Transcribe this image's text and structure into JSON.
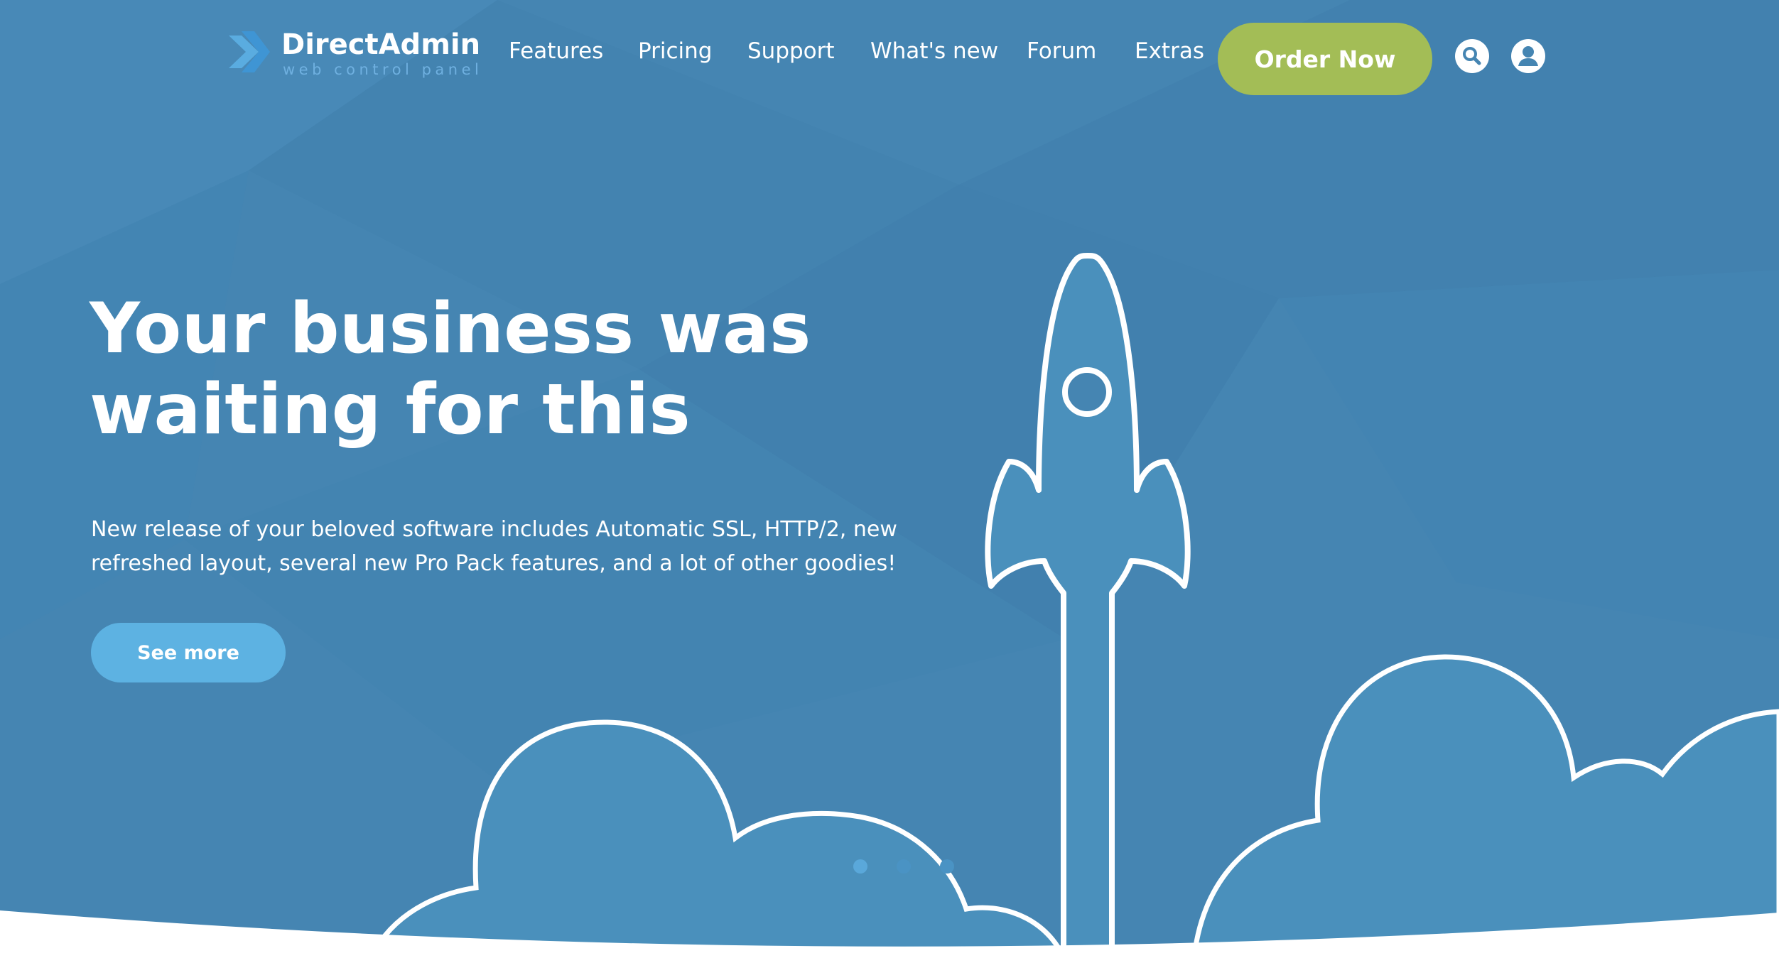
{
  "colors": {
    "background": "#4585b2",
    "cta_green": "#a3bd56",
    "secondary_button": "#5db2e2",
    "cloud_fill": "#4a90bc",
    "white": "#ffffff",
    "logo_accent": "#5aace0"
  },
  "logo": {
    "name": "DirectAdmin",
    "tagline": "web control panel",
    "icon": "directadmin-chevron-icon"
  },
  "nav": {
    "links": [
      {
        "label": "Features"
      },
      {
        "label": "Pricing"
      },
      {
        "label": "Support"
      },
      {
        "label": "What's new"
      },
      {
        "label": "Forum"
      },
      {
        "label": "Extras"
      }
    ],
    "order_label": "Order Now",
    "search_icon": "search-icon",
    "account_icon": "user-account-icon"
  },
  "hero": {
    "title_line1": "Your business was",
    "title_line2": "waiting for this",
    "description": "New release of your beloved software includes Automatic SSL, HTTP/2, new refreshed layout, several new Pro Pack features, and a lot of other goodies!",
    "button_label": "See more",
    "illustration": "rocket-launch-icon"
  },
  "carousel": {
    "slide_count": 3,
    "active_index": 0
  }
}
